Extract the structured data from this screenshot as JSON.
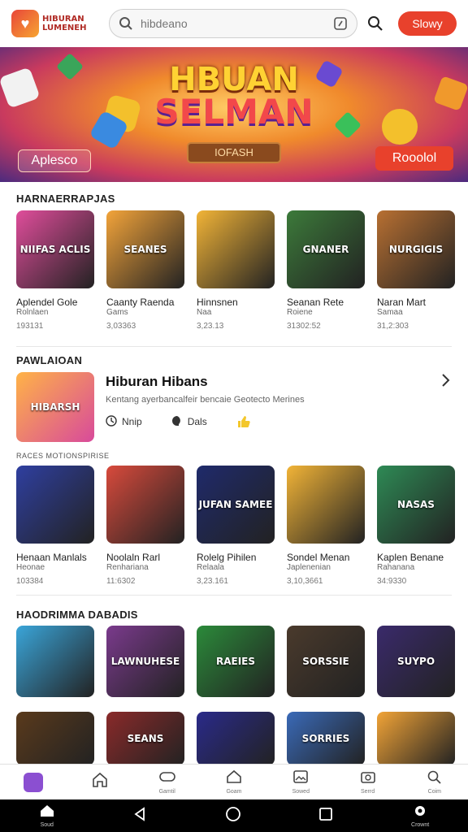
{
  "header": {
    "logo_line1": "HIBURAN",
    "logo_line2": "LUMENEH",
    "search_placeholder": "hibdeano",
    "signin_label": "Slowy"
  },
  "banner": {
    "title_line1": "HBUAN",
    "title_line2": "SELMAN",
    "subtitle": "IOFASH",
    "left_button": "Aplesco",
    "right_button": "Rooolol"
  },
  "section1": {
    "title": "HARNAERRAPJAS",
    "games": [
      {
        "thumb_text": "NIIFAS\nACLIS",
        "name": "Aplendel Gole",
        "sub": "Rolnlaen",
        "count": "193131",
        "bg": "#e04d9b"
      },
      {
        "thumb_text": "SEANES",
        "name": "Caanty Raenda",
        "sub": "Gams",
        "count": "3,03363",
        "bg": "#f3a43a"
      },
      {
        "thumb_text": "",
        "name": "Hinnsnen",
        "sub": "Naa",
        "count": "3,23.13",
        "bg": "#f2b437"
      },
      {
        "thumb_text": "GNANER",
        "name": "Seanan Rete",
        "sub": "Roiene",
        "count": "31302:52",
        "bg": "#3c7a3a"
      },
      {
        "thumb_text": "NURGIGIS",
        "name": "Naran Mart",
        "sub": "Samaa",
        "count": "31,2:303",
        "bg": "#b87032"
      }
    ]
  },
  "featured": {
    "section_title": "PAWLAIOAN",
    "thumb_text": "HIBARSH",
    "title": "Hiburan Hibans",
    "desc": "Kentang ayerbancalfeir bencaie Geotecto Merines",
    "meta1": "Nnip",
    "meta2": "Dals"
  },
  "section2": {
    "label": "RACES MOTIONSPIRISE",
    "games": [
      {
        "thumb_text": "",
        "name": "Henaan Manlals",
        "sub": "Heonae",
        "count": "103384",
        "bg": "#2f3fa0"
      },
      {
        "thumb_text": "",
        "name": "Noolaln Rarl",
        "sub": "Renhariana",
        "count": "11:6302",
        "bg": "#d84a3c"
      },
      {
        "thumb_text": "JUFAN\nSAMEE",
        "name": "Rolelg Pihilen",
        "sub": "Relaala",
        "count": "3,23.161",
        "bg": "#1f2a6b"
      },
      {
        "thumb_text": "",
        "name": "Sondel Menan",
        "sub": "Japlenenian",
        "count": "3,10,3661",
        "bg": "#f2b437"
      },
      {
        "thumb_text": "NASAS",
        "name": "Kaplen Benane",
        "sub": "Rahanana",
        "count": "34:9330",
        "bg": "#2e8a55"
      }
    ]
  },
  "section3": {
    "title": "HAODRIMMA DABADIS",
    "games": [
      {
        "thumb_text": "",
        "bg": "#3aa5d9"
      },
      {
        "thumb_text": "LAWNUHESE",
        "bg": "#7a3a8c"
      },
      {
        "thumb_text": "RAEIES",
        "bg": "#2b8a3a"
      },
      {
        "thumb_text": "SORSSIE",
        "bg": "#4a3a2c"
      },
      {
        "thumb_text": "SUYPO",
        "bg": "#3a2a6b"
      }
    ],
    "games_row2": [
      {
        "thumb_text": "",
        "bg": "#5a3a1c"
      },
      {
        "thumb_text": "SEANS",
        "bg": "#8a2a2a"
      },
      {
        "thumb_text": "",
        "bg": "#2a2a8a"
      },
      {
        "thumb_text": "SORRIES",
        "bg": "#3a6ab8"
      },
      {
        "thumb_text": "",
        "bg": "#f2a437"
      }
    ]
  },
  "bottom_nav": {
    "items": [
      {
        "label": "",
        "icon": "app-icon"
      },
      {
        "label": "",
        "icon": "home-icon"
      },
      {
        "label": "Gamtil",
        "icon": "controller-icon"
      },
      {
        "label": "Goam",
        "icon": "house-icon"
      },
      {
        "label": "Sowed",
        "icon": "photo-icon"
      },
      {
        "label": "Serrd",
        "icon": "camera-icon"
      },
      {
        "label": "Coim",
        "icon": "search-icon"
      }
    ]
  },
  "system_bar": {
    "home_label": "Soud",
    "settings_label": "Crownt"
  }
}
